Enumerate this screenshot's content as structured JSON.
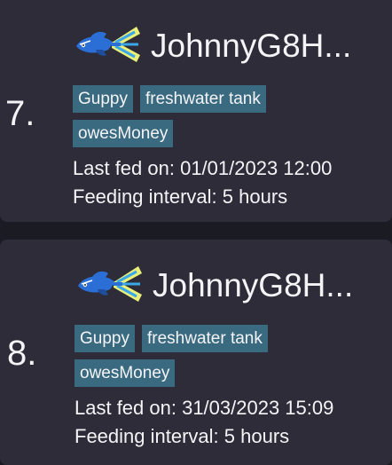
{
  "entries": [
    {
      "rank": "7.",
      "name": "JohnnyG8H...",
      "icon": "guppy-fish-icon",
      "tags": [
        "Guppy",
        "freshwater tank",
        "owesMoney"
      ],
      "last_fed": "Last fed on: 01/01/2023 12:00",
      "feeding_interval": "Feeding interval: 5 hours"
    },
    {
      "rank": "8.",
      "name": "JohnnyG8H...",
      "icon": "guppy-fish-icon",
      "tags": [
        "Guppy",
        "freshwater tank",
        "owesMoney"
      ],
      "last_fed": "Last fed on: 31/03/2023 15:09",
      "feeding_interval": "Feeding interval: 5 hours"
    }
  ],
  "colors": {
    "background": "#1b1b23",
    "card": "#2d2c38",
    "tag": "#3a6a80",
    "text": "#f4f4f7",
    "fish_body": "#2b6fd6",
    "fish_tail_yellow": "#e8f07a",
    "fish_tail_blue": "#3aa7e8"
  }
}
